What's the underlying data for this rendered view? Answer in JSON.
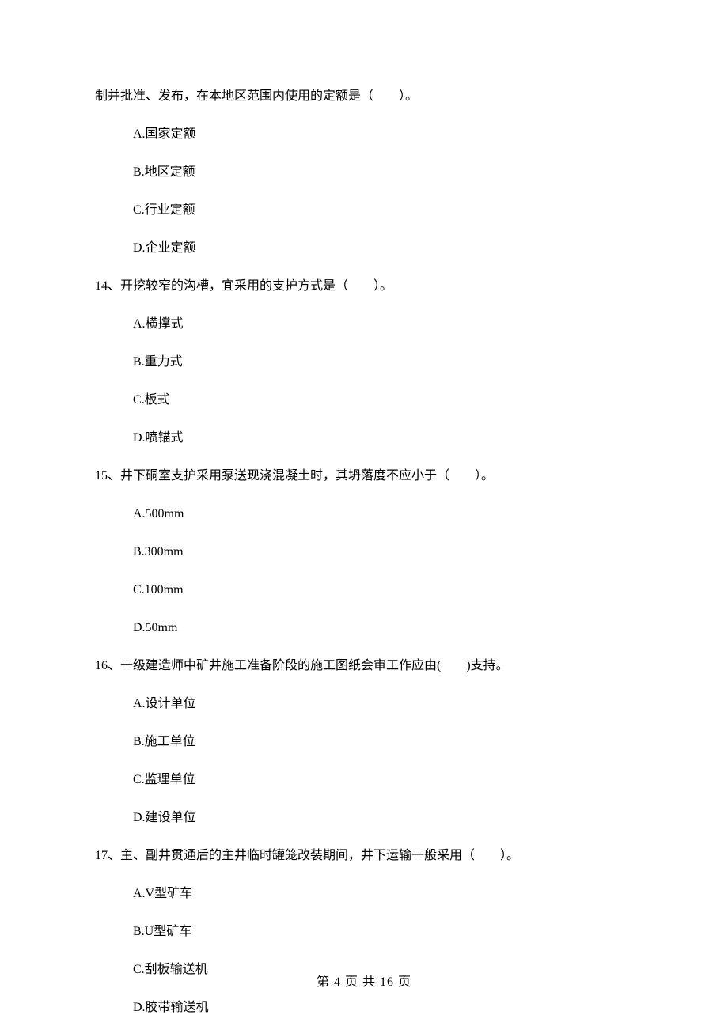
{
  "q13_continuation": "制并批准、发布，在本地区范围内使用的定额是（　　）。",
  "q13_options": {
    "a": "A.国家定额",
    "b": "B.地区定额",
    "c": "C.行业定额",
    "d": "D.企业定额"
  },
  "q14": {
    "text": "14、开挖较窄的沟槽，宜采用的支护方式是（　　）。",
    "options": {
      "a": "A.横撑式",
      "b": "B.重力式",
      "c": "C.板式",
      "d": "D.喷锚式"
    }
  },
  "q15": {
    "text": "15、井下硐室支护采用泵送现浇混凝土时，其坍落度不应小于（　　）。",
    "options": {
      "a": "A.500mm",
      "b": "B.300mm",
      "c": "C.100mm",
      "d": "D.50mm"
    }
  },
  "q16": {
    "text": "16、一级建造师中矿井施工准备阶段的施工图纸会审工作应由(　　)支持。",
    "options": {
      "a": "A.设计单位",
      "b": "B.施工单位",
      "c": "C.监理单位",
      "d": "D.建设单位"
    }
  },
  "q17": {
    "text": "17、主、副井贯通后的主井临时罐笼改装期间，井下运输一般采用（　　）。",
    "options": {
      "a": "A.V型矿车",
      "b": "B.U型矿车",
      "c": "C.刮板输送机",
      "d": "D.胶带输送机"
    }
  },
  "footer": "第 4 页 共 16 页"
}
